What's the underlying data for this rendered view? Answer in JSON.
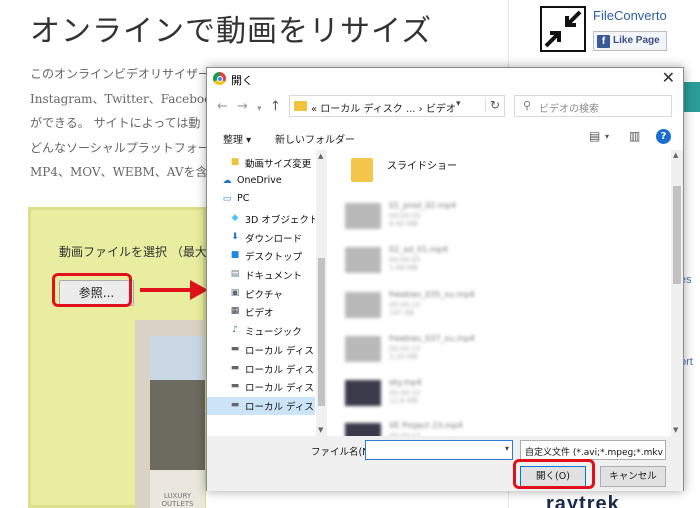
{
  "site": {
    "title": "オンラインで動画をリサイズ",
    "para_lines": [
      "このオンラインビデオリサイザー",
      "Instagram、Twitter、Facebook",
      "ができる。 サイトによっては動",
      "どんなソーシャルプラットフォー",
      "MP4、MOV、WEBM、AVを含む"
    ],
    "upload_label": "動画ファイルを選択 （最大",
    "browse_label": "参照...",
    "preview_caption": "LUXURY OUTLETS",
    "brand_name": "FileConverto",
    "like_label": "Like Page",
    "side_letters": [
      "es",
      "ort"
    ],
    "sidebar_ad": "raytrek"
  },
  "dialog": {
    "title": "開く",
    "breadcrumb": "« ローカル ディスク ... › ビデオ",
    "search_placeholder": "ビデオの検索",
    "toolbar": {
      "organize": "整理 ▾",
      "new_folder": "新しいフォルダー"
    },
    "nav_items": [
      {
        "label": "動画サイズ変更",
        "icon": "folder-icon",
        "icon_glyph": "■",
        "color": "#f1c33d"
      },
      {
        "label": "OneDrive",
        "icon": "cloud-icon",
        "icon_glyph": "☁",
        "color": "#1976d2"
      },
      {
        "label": "PC",
        "icon": "pc-icon",
        "icon_glyph": "▭",
        "color": "#1e88e5"
      },
      {
        "label": "3D オブジェクト",
        "icon": "cube-icon",
        "icon_glyph": "◆",
        "color": "#4fc3f7"
      },
      {
        "label": "ダウンロード",
        "icon": "download-icon",
        "icon_glyph": "⬇",
        "color": "#1e6fd0"
      },
      {
        "label": "デスクトップ",
        "icon": "desktop-icon",
        "icon_glyph": "■",
        "color": "#1e88e5"
      },
      {
        "label": "ドキュメント",
        "icon": "document-icon",
        "icon_glyph": "▤",
        "color": "#607d8b"
      },
      {
        "label": "ピクチャ",
        "icon": "picture-icon",
        "icon_glyph": "▣",
        "color": "#5c6b7a"
      },
      {
        "label": "ビデオ",
        "icon": "video-icon",
        "icon_glyph": "▦",
        "color": "#37474f"
      },
      {
        "label": "ミュージック",
        "icon": "music-icon",
        "icon_glyph": "♪",
        "color": "#1e6fd0"
      },
      {
        "label": "ローカル ディスク (C",
        "icon": "drive-icon",
        "icon_glyph": "▬",
        "color": "#666"
      },
      {
        "label": "ローカル ディスク (D",
        "icon": "drive-icon",
        "icon_glyph": "▬",
        "color": "#666"
      },
      {
        "label": "ローカル ディスク (E",
        "icon": "drive-icon",
        "icon_glyph": "▬",
        "color": "#666"
      },
      {
        "label": "ローカル ディスク (F",
        "icon": "drive-icon",
        "icon_glyph": "▬",
        "color": "#666"
      }
    ],
    "selected_nav": "ローカル ディスク (F",
    "files": [
      {
        "name": "スライドショー",
        "meta": [
          "",
          ""
        ],
        "type": "folder"
      },
      {
        "name": "01_prod_02.mp4",
        "meta": [
          "00:00:05",
          "4.00 MB"
        ],
        "type": "video"
      },
      {
        "name": "02_ad_01.mp4",
        "meta": [
          "00:00:05",
          "1.08 MB"
        ],
        "type": "video"
      },
      {
        "name": "freebies_035_xu.mp4",
        "meta": [
          "00:00:15",
          "147 KB"
        ],
        "type": "video"
      },
      {
        "name": "freebies_037_xu.mp4",
        "meta": [
          "00:00:15",
          "3.33 MB"
        ],
        "type": "video"
      },
      {
        "name": "sky.mp4",
        "meta": [
          "00:00:12",
          "12.6 MB"
        ],
        "type": "dark"
      },
      {
        "name": "VE Project 23.mp4",
        "meta": [
          "00:00:17",
          "5.00 MB"
        ],
        "type": "dark"
      }
    ],
    "filename_label": "ファイル名(N):",
    "filename_value": "",
    "filter_value": "自定义文件 (*.avi;*.mpeg;*.mkv",
    "open_label": "開く(O)",
    "cancel_label": "キャンセル"
  },
  "colors": {
    "highlight": "#e0111b",
    "panel_bg": "#e9eda0",
    "selection": "#cce4f7",
    "accent_blue": "#0078d7"
  }
}
